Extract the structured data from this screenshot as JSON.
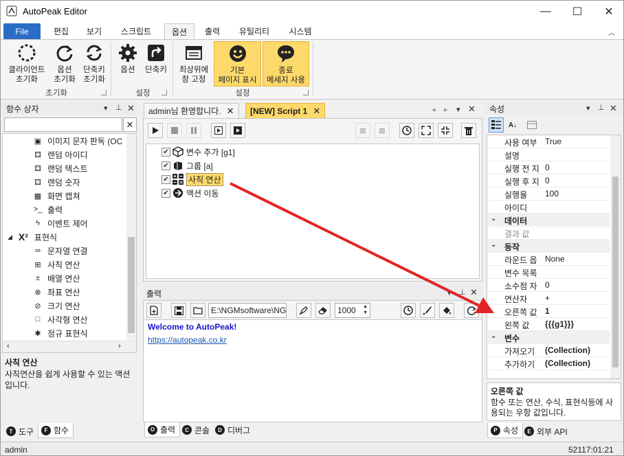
{
  "window": {
    "title": "AutoPeak Editor",
    "minimize_glyph": "—",
    "maximize_glyph": "☐",
    "close_glyph": "✕"
  },
  "ribbon": {
    "file_tab": "File",
    "tabs": [
      "편집",
      "보기",
      "스크립트",
      "옵션",
      "출력",
      "유틸리티",
      "시스템"
    ],
    "active_tab": "옵션",
    "groups": [
      {
        "label": "초기화",
        "buttons": [
          {
            "line1": "클라이언트",
            "line2": "초기화"
          },
          {
            "line1": "옵션",
            "line2": "초기화"
          },
          {
            "line1": "단축키",
            "line2": "초기화"
          }
        ]
      },
      {
        "label": "설정",
        "buttons": [
          {
            "line1": "옵션",
            "line2": ""
          },
          {
            "line1": "단축키",
            "line2": ""
          }
        ]
      },
      {
        "label": "설정",
        "buttons": [
          {
            "line1": "최상위에",
            "line2": "창 고정"
          },
          {
            "line1": "기본",
            "line2": "페이지 표시"
          },
          {
            "line1": "종료",
            "line2": "메세지 사용"
          }
        ]
      }
    ]
  },
  "left_panel": {
    "title": "함수 상자",
    "search_value": "",
    "items": [
      {
        "label": "이미지 문자 판독 (OC",
        "icon": "ocr-icon"
      },
      {
        "label": "랜덤 아이디",
        "icon": "dice-icon"
      },
      {
        "label": "랜덤 텍스트",
        "icon": "dice-icon"
      },
      {
        "label": "랜덤 숫자",
        "icon": "dice-icon"
      },
      {
        "label": "화면 캡쳐",
        "icon": "capture-icon"
      },
      {
        "label": "출력",
        "icon": "console-icon"
      },
      {
        "label": "이벤트 제어",
        "icon": "bolt-icon"
      },
      {
        "label": "표현식",
        "icon": "x-squared-icon"
      },
      {
        "label": "문자열 연결",
        "icon": "link-icon"
      },
      {
        "label": "사칙 연산",
        "icon": "calculator-icon"
      },
      {
        "label": "배열 연산",
        "icon": "plus-minus-icon"
      },
      {
        "label": "좌표 연산",
        "icon": "xy-icon"
      },
      {
        "label": "크기 연산",
        "icon": "size-icon"
      },
      {
        "label": "사각형 연산",
        "icon": "rectangle-icon"
      },
      {
        "label": "정규 표현식",
        "icon": "asterisk-icon"
      }
    ],
    "description_title": "사칙 연산",
    "description": "사칙연산을 쉽게 사용할 수 있는 액션입니다.",
    "bottom_tabs": [
      {
        "letter": "T",
        "label": "도구"
      },
      {
        "letter": "F",
        "label": "함수"
      }
    ]
  },
  "editor": {
    "tabs": [
      {
        "label": "admin님 환영합니다."
      },
      {
        "label": "[NEW] Script 1"
      }
    ],
    "script_items": [
      {
        "label": "변수 추가 [g1]",
        "checked": "✔"
      },
      {
        "label": "그룹 [a]",
        "checked": "✔"
      },
      {
        "label": "사칙 연산",
        "checked": "✔"
      },
      {
        "label": "액션 이동",
        "checked": "✔"
      }
    ]
  },
  "output": {
    "title": "출력",
    "path_value": "E:\\NGMsoftware\\NG",
    "delay_value": "1000",
    "lines": [
      "Welcome to AutoPeak!",
      "https://autopeak.co.kr"
    ],
    "bottom_tabs": [
      {
        "letter": "O",
        "label": "출력"
      },
      {
        "letter": "C",
        "label": "콘솔"
      },
      {
        "letter": "D",
        "label": "디버그"
      }
    ]
  },
  "properties": {
    "title": "속성",
    "rows": [
      {
        "type": "row",
        "key": "사용 여부",
        "value": "True"
      },
      {
        "type": "row",
        "key": "설명",
        "value": ""
      },
      {
        "type": "row",
        "key": "실행 전 지",
        "value": "0"
      },
      {
        "type": "row",
        "key": "실행 후 지",
        "value": "0"
      },
      {
        "type": "row",
        "key": "실행율",
        "value": "100"
      },
      {
        "type": "row",
        "key": "아이디",
        "value": ""
      },
      {
        "type": "cat",
        "key": "데이터",
        "value": ""
      },
      {
        "type": "row",
        "key": "결과 값",
        "value": ""
      },
      {
        "type": "cat",
        "key": "동작",
        "value": ""
      },
      {
        "type": "row",
        "key": "라운드 옵",
        "value": "None"
      },
      {
        "type": "row",
        "key": "변수 목록",
        "value": ""
      },
      {
        "type": "row",
        "key": "소수점 자",
        "value": "0"
      },
      {
        "type": "row",
        "key": "연산자",
        "value": "+"
      },
      {
        "type": "row",
        "key": "오른쪽 값",
        "value": "1"
      },
      {
        "type": "row",
        "key": "왼쪽 값",
        "value": "{{{g1}}}"
      },
      {
        "type": "cat",
        "key": "변수",
        "value": ""
      },
      {
        "type": "row",
        "key": "가져오기",
        "value": "(Collection)"
      },
      {
        "type": "row",
        "key": "추가하기",
        "value": "(Collection)"
      }
    ],
    "description_title": "오른쪽 값",
    "description": "함수 또는 연산, 수식, 표현식등에 사용되는 우항 값입니다.",
    "bottom_tabs": [
      {
        "letter": "P",
        "label": "속성"
      },
      {
        "letter": "E",
        "label": "외부 API"
      }
    ]
  },
  "status": {
    "user": "admin",
    "clock": "52117:01:21"
  },
  "colors": {
    "accent": "#2b6cc4",
    "highlight": "#fcd96a",
    "arrow": "#e32424"
  }
}
